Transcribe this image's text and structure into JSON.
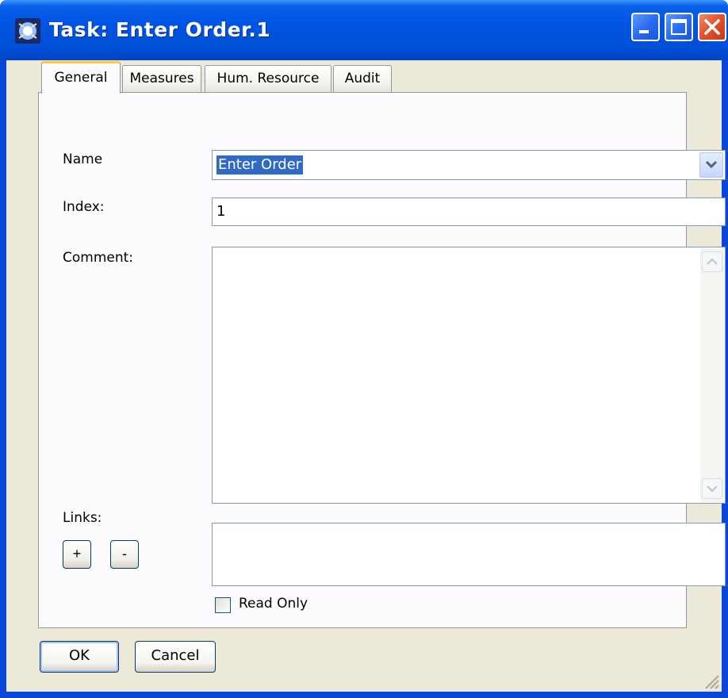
{
  "window": {
    "title": "Task: Enter Order.1",
    "controls": [
      "minimize-icon",
      "maximize-icon",
      "close-icon"
    ]
  },
  "tabs": [
    {
      "label": "General",
      "active": true
    },
    {
      "label": "Measures",
      "active": false
    },
    {
      "label": "Hum. Resource",
      "active": false
    },
    {
      "label": "Audit",
      "active": false
    }
  ],
  "form": {
    "name_label": "Name",
    "name_value": "Enter Order",
    "index_label": "Index:",
    "index_value": "1",
    "comment_label": "Comment:",
    "comment_value": "",
    "links_label": "Links:",
    "add_link_label": "+",
    "remove_link_label": "-",
    "read_only_label": "Read Only",
    "read_only_checked": false
  },
  "buttons": {
    "ok_label": "OK",
    "cancel_label": "Cancel"
  },
  "colors": {
    "titlebar": "#0054e3",
    "dialog_bg": "#ece9d8",
    "selection": "#316ac5",
    "active_tab_accent": "#ffc83c"
  }
}
